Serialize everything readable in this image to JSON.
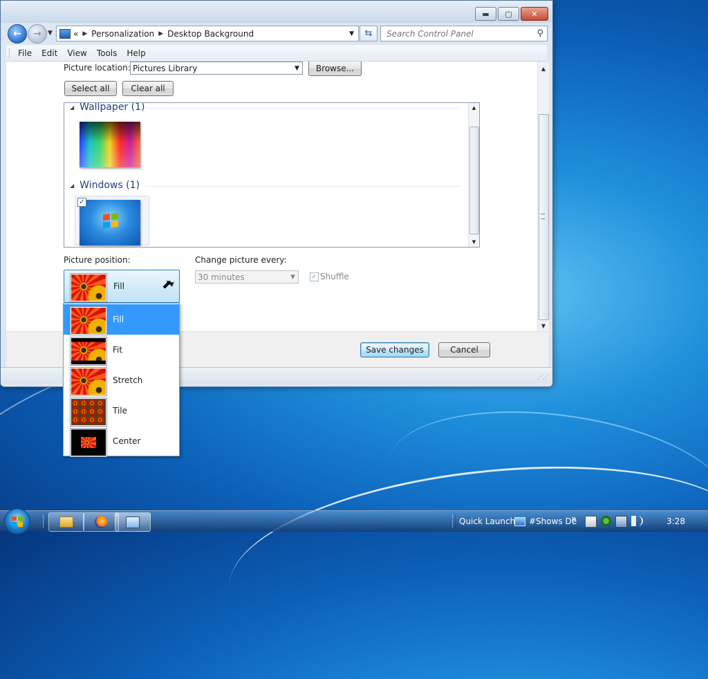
{
  "window": {
    "caption_minimize": "▬",
    "caption_maximize": "▢",
    "caption_close": "✕"
  },
  "address": {
    "prefix": "«",
    "crumbs": [
      "Personalization",
      "Desktop Background"
    ],
    "search_placeholder": "Search Control Panel"
  },
  "menu": [
    "File",
    "Edit",
    "View",
    "Tools",
    "Help"
  ],
  "content": {
    "picture_location_label": "Picture location:",
    "picture_location_value": "Pictures Library",
    "browse_label": "Browse...",
    "select_all_label": "Select all",
    "clear_all_label": "Clear all",
    "groups": [
      {
        "title": "Wallpaper (1)"
      },
      {
        "title": "Windows (1)"
      }
    ],
    "picture_position_label": "Picture position:",
    "picture_position_value": "Fill",
    "change_picture_label": "Change picture every:",
    "change_picture_value": "30 minutes",
    "shuffle_label": "Shuffle",
    "save_label": "Save changes",
    "cancel_label": "Cancel"
  },
  "position_options": [
    "Fill",
    "Fit",
    "Stretch",
    "Tile",
    "Center"
  ],
  "taskbar": {
    "quick_launch": "Quick Launch",
    "shows_desktop": "#Shows De",
    "overflow": "»",
    "clock": "3:28"
  },
  "colors": {
    "selection": "#3399ff",
    "desktop": "#1f8fdc"
  }
}
